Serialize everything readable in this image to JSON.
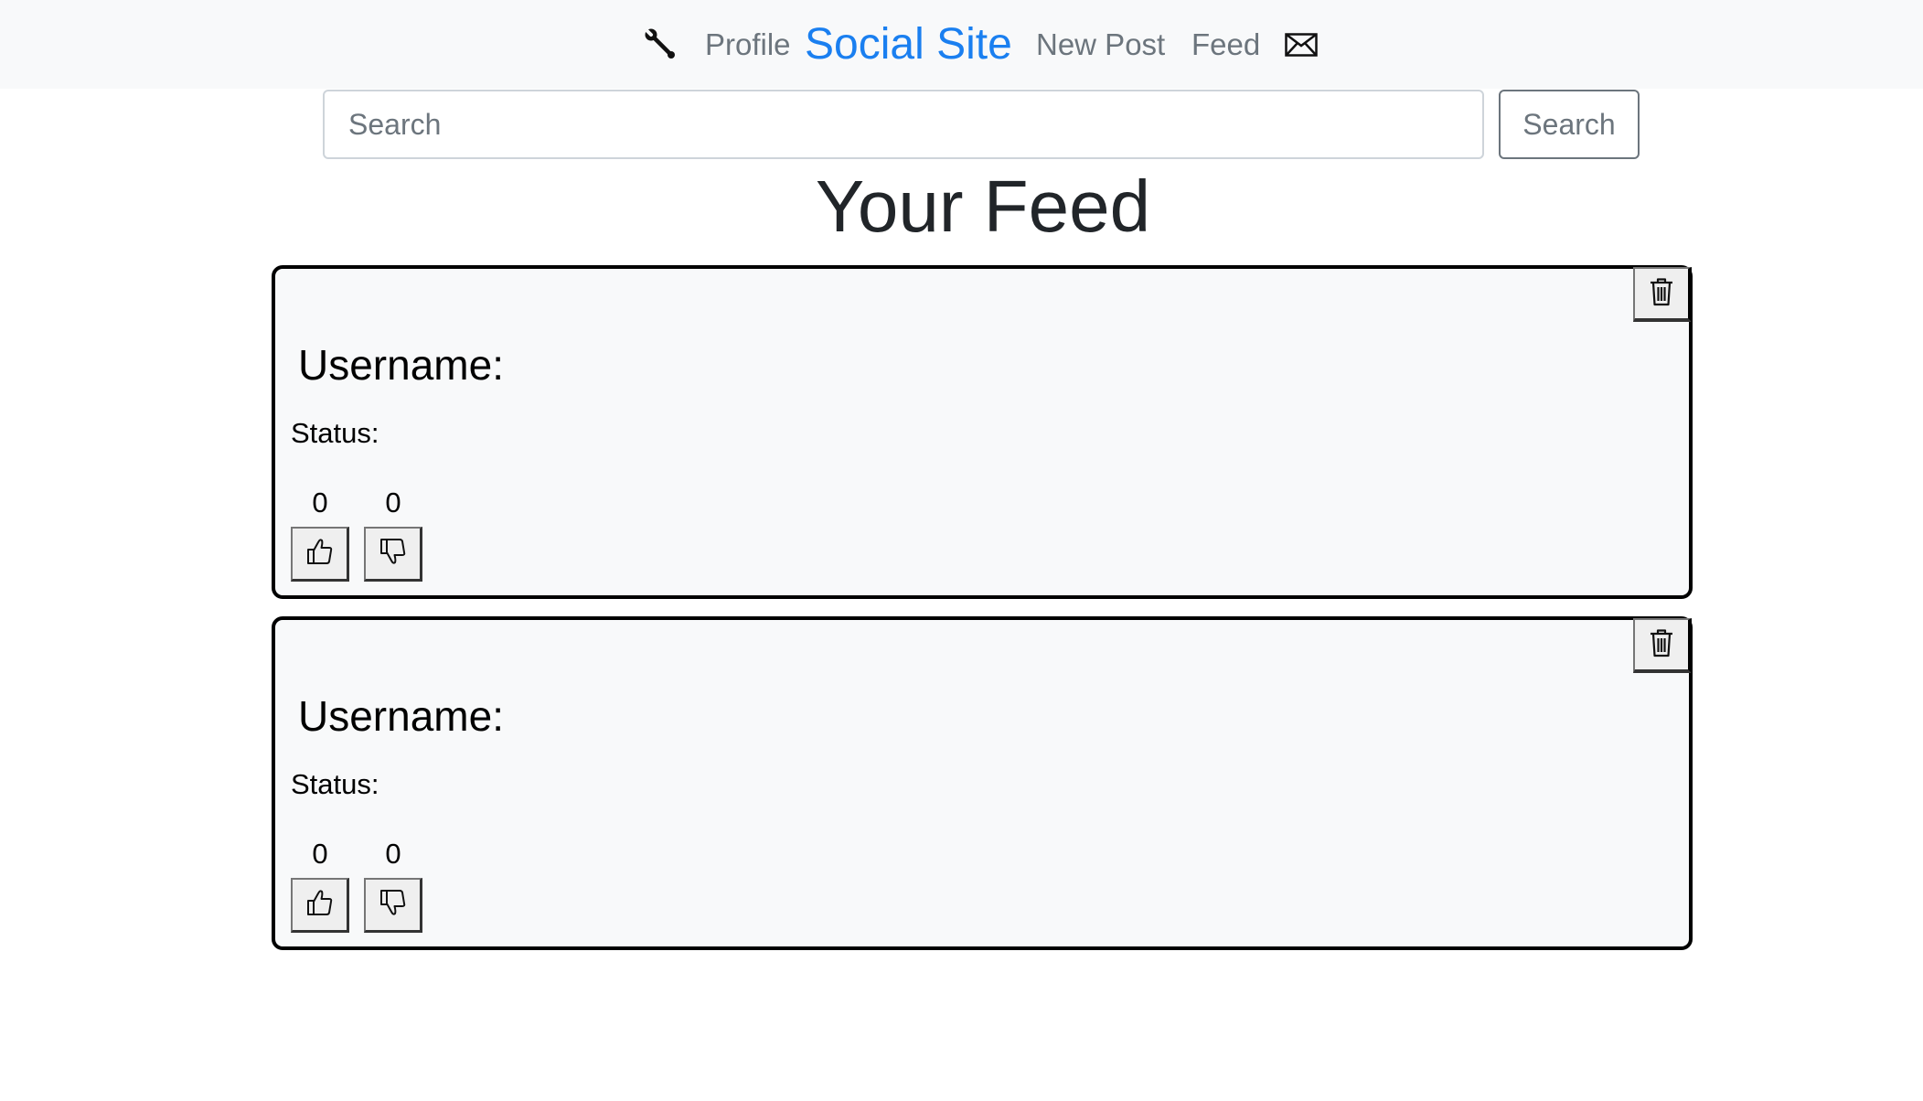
{
  "navbar": {
    "settings_icon": "wrench-icon",
    "profile_label": "Profile",
    "brand_label": "Social Site",
    "new_post_label": "New Post",
    "feed_label": "Feed",
    "messages_icon": "envelope-icon"
  },
  "search": {
    "placeholder": "Search",
    "value": "",
    "button_label": "Search"
  },
  "page": {
    "title": "Your Feed"
  },
  "posts": [
    {
      "username_label": "Username:",
      "status_label": "Status:",
      "likes": "0",
      "dislikes": "0",
      "delete_icon": "trash-icon",
      "like_icon": "thumbs-up-icon",
      "dislike_icon": "thumbs-down-icon"
    },
    {
      "username_label": "Username:",
      "status_label": "Status:",
      "likes": "0",
      "dislikes": "0",
      "delete_icon": "trash-icon",
      "like_icon": "thumbs-up-icon",
      "dislike_icon": "thumbs-down-icon"
    }
  ],
  "colors": {
    "brand": "#1a7ff0",
    "navbar_background": "#f8f9fa",
    "nav_link": "#6c757d",
    "card_background": "#f8f9fa",
    "card_border": "#000000"
  }
}
